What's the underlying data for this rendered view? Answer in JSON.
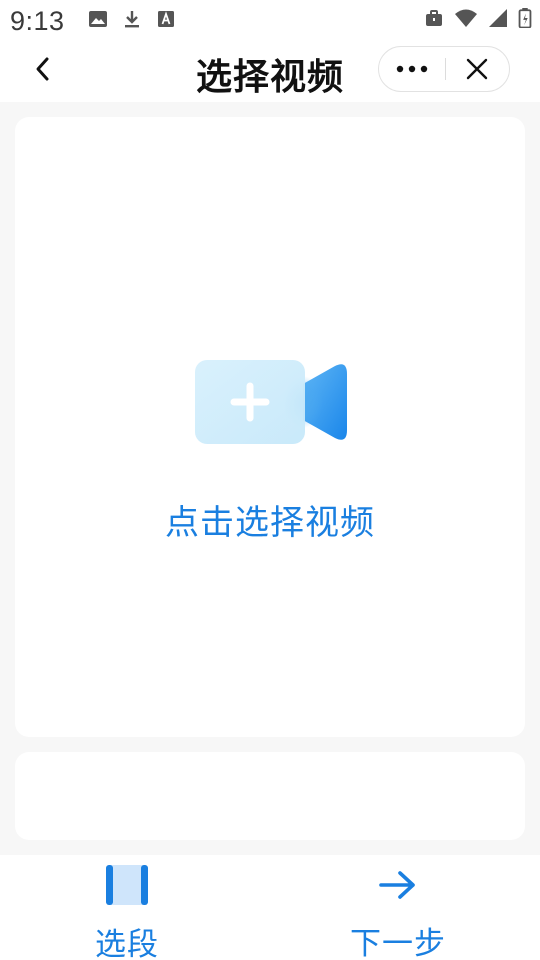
{
  "status_bar": {
    "time": "9:13",
    "left_icons": [
      "image-icon",
      "download-icon",
      "text-a-icon"
    ],
    "right_icons": [
      "briefcase-icon",
      "wifi-icon",
      "signal-icon",
      "battery-icon"
    ]
  },
  "header": {
    "title": "选择视频",
    "back_icon": "chevron-left-icon",
    "more_icon": "more-dots-icon",
    "close_icon": "close-icon"
  },
  "main": {
    "select_label": "点击选择视频",
    "video_add_icon": "video-add-icon"
  },
  "bottom_bar": {
    "segment_label": "选段",
    "next_label": "下一步"
  },
  "colors": {
    "accent": "#1a7fe0",
    "page_bg": "#f7f7f7",
    "card_bg": "#ffffff",
    "title": "#111111"
  }
}
